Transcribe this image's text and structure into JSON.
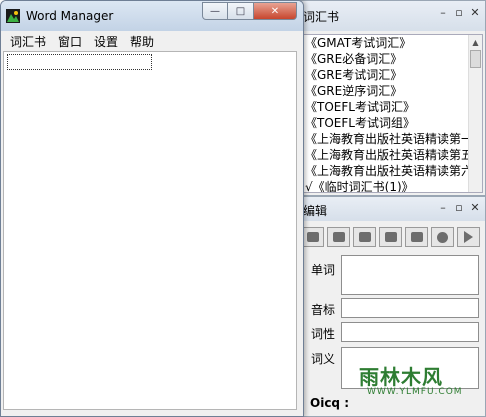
{
  "main_window": {
    "title": "Word Manager",
    "controls": {
      "minimize": "—",
      "maximize": "□",
      "close": "✕"
    },
    "menu": [
      "词汇书",
      "窗口",
      "设置",
      "帮助"
    ]
  },
  "book_window": {
    "title": "词汇书",
    "books": [
      "《GMAT考试词汇》",
      "《GRE必备词汇》",
      "《GRE考试词汇》",
      "《GRE逆序词汇》",
      "《TOEFL考试词汇》",
      "《TOEFL考试词组》",
      "《上海教育出版社英语精读第一",
      "《上海教育出版社英语精读第五",
      "《上海教育出版社英语精读第六",
      "√《临时词汇书(1)》"
    ],
    "controls": {
      "minimize": "–",
      "restore": "▫",
      "close": "✕"
    }
  },
  "edit_window": {
    "title": "编辑",
    "controls": {
      "minimize": "–",
      "restore": "▫",
      "close": "✕"
    },
    "fields": {
      "word_label": "单词",
      "phonetic_label": "音标",
      "pos_label": "词性",
      "meaning_label": "词义"
    },
    "oicq_label": "Oicq :"
  },
  "watermark": {
    "text": "雨林木风",
    "subtext": "WWW.YLMFU.COM"
  },
  "colors": {
    "close_button": "#c7462e",
    "titlebar": "#c3d3e6",
    "watermark": "#2e7d32"
  }
}
